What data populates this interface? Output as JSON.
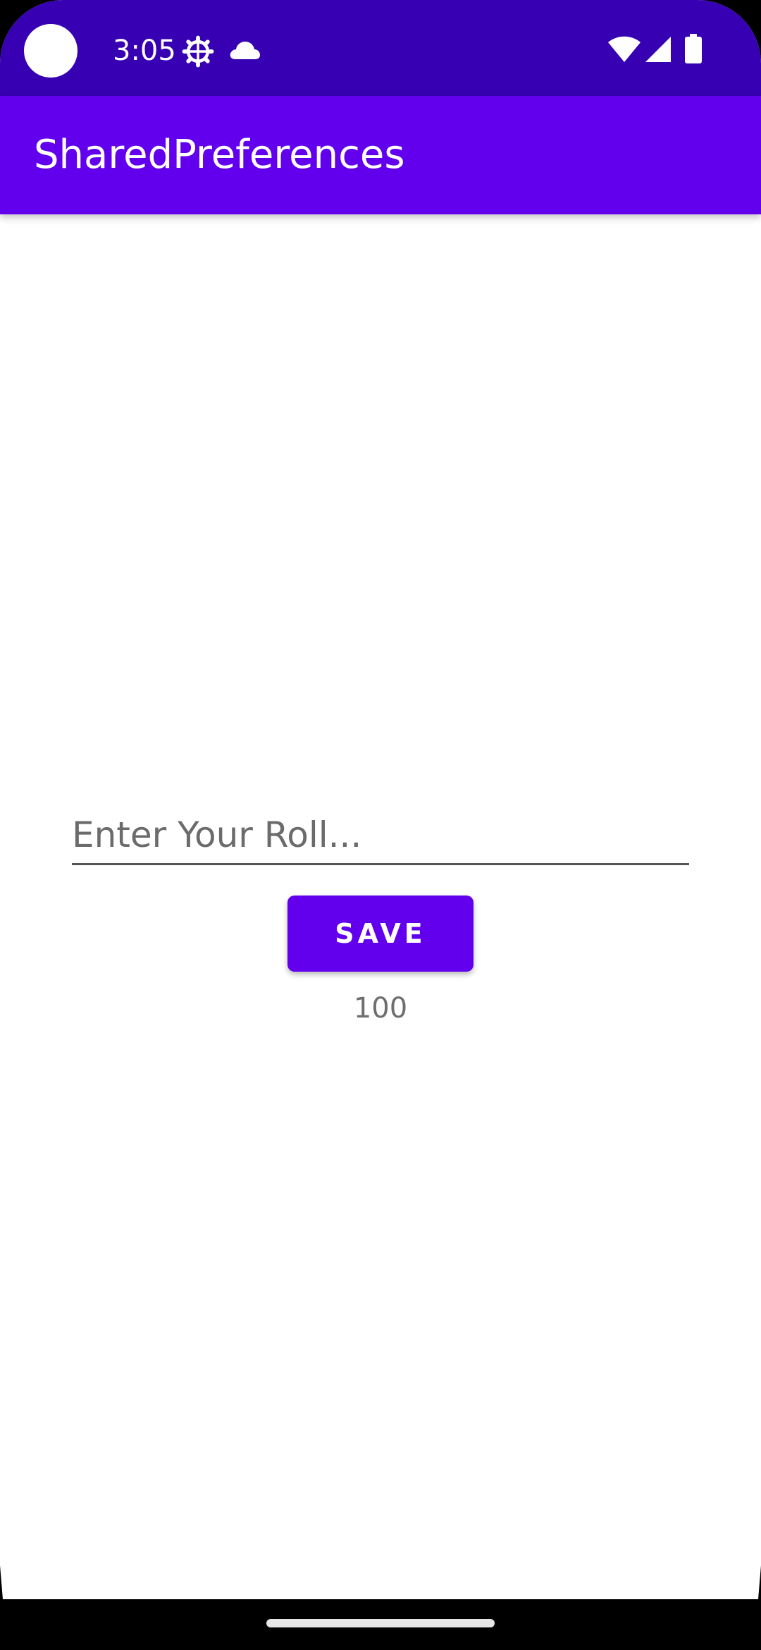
{
  "status_bar": {
    "time": "3:05",
    "left_icons": [
      "settings-gear-icon",
      "cloud-icon"
    ],
    "right_icons": [
      "wifi-icon",
      "cellular-signal-icon",
      "battery-icon"
    ]
  },
  "app_bar": {
    "title": "SharedPreferences"
  },
  "form": {
    "roll_input": {
      "placeholder": "Enter Your Roll...",
      "value": ""
    },
    "save_button_label": "SAVE",
    "result_text": "100"
  },
  "colors": {
    "status_bar": "#3700b3",
    "primary": "#6200ee",
    "background": "#ffffff"
  }
}
